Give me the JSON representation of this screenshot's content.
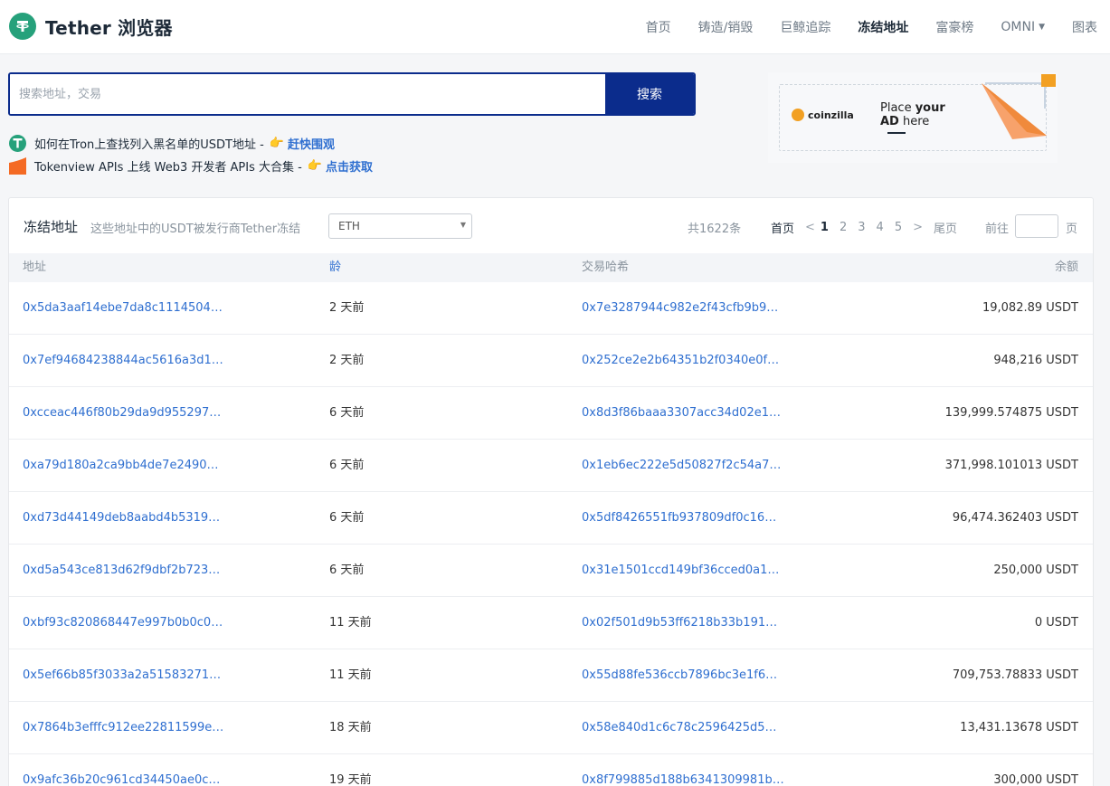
{
  "header": {
    "brand": "Tether 浏览器",
    "nav": [
      {
        "label": "首页"
      },
      {
        "label": "铸造/销毁"
      },
      {
        "label": "巨鲸追踪"
      },
      {
        "label": "冻结地址",
        "active": true
      },
      {
        "label": "富豪榜"
      },
      {
        "label": "OMNI"
      },
      {
        "label": "图表"
      }
    ]
  },
  "search": {
    "placeholder": "搜索地址，交易",
    "button": "搜索"
  },
  "notices": [
    {
      "text": "如何在Tron上查找列入黑名单的USDT地址 -",
      "link": "赶快围观"
    },
    {
      "text": "Tokenview APIs 上线 Web3 开发者 APIs 大合集 -",
      "link": "点击获取"
    }
  ],
  "ad": {
    "brand": "coinzilla",
    "line1_a": "Place ",
    "line1_b": "your",
    "line2_a": "AD",
    "line2_b": " here"
  },
  "panel": {
    "title": "冻结地址",
    "subtitle": "这些地址中的USDT被发行商Tether冻结",
    "chain_select": "ETH",
    "total": "共1622条",
    "pager": {
      "first": "首页",
      "prev": "<",
      "pages": [
        "1",
        "2",
        "3",
        "4",
        "5"
      ],
      "next": ">",
      "last": "尾页",
      "goto": "前往",
      "unit": "页"
    },
    "columns": {
      "address": "地址",
      "age": "龄",
      "tx_hash": "交易哈希",
      "balance": "余额"
    },
    "rows": [
      {
        "address": "0x5da3aaf14ebe7da8c1114504…",
        "age": "2 天前",
        "tx": "0x7e3287944c982e2f43cfb9b9…",
        "balance": "19,082.89 USDT"
      },
      {
        "address": "0x7ef94684238844ac5616a3d1…",
        "age": "2 天前",
        "tx": "0x252ce2e2b64351b2f0340e0f…",
        "balance": "948,216 USDT"
      },
      {
        "address": "0xcceac446f80b29da9d955297…",
        "age": "6 天前",
        "tx": "0x8d3f86baaa3307acc34d02e1…",
        "balance": "139,999.574875 USDT"
      },
      {
        "address": "0xa79d180a2ca9bb4de7e2490…",
        "age": "6 天前",
        "tx": "0x1eb6ec222e5d50827f2c54a7…",
        "balance": "371,998.101013 USDT"
      },
      {
        "address": "0xd73d44149deb8aabd4b5319…",
        "age": "6 天前",
        "tx": "0x5df8426551fb937809df0c16…",
        "balance": "96,474.362403 USDT"
      },
      {
        "address": "0xd5a543ce813d62f9dbf2b723…",
        "age": "6 天前",
        "tx": "0x31e1501ccd149bf36cced0a1…",
        "balance": "250,000 USDT"
      },
      {
        "address": "0xbf93c820868447e997b0b0c0…",
        "age": "11 天前",
        "tx": "0x02f501d9b53ff6218b33b191…",
        "balance": "0 USDT"
      },
      {
        "address": "0x5ef66b85f3033a2a51583271…",
        "age": "11 天前",
        "tx": "0x55d88fe536ccb7896bc3e1f6…",
        "balance": "709,753.78833 USDT"
      },
      {
        "address": "0x7864b3efffc912ee22811599e…",
        "age": "18 天前",
        "tx": "0x58e840d1c6c78c2596425d5…",
        "balance": "13,431.13678 USDT"
      },
      {
        "address": "0x9afc36b20c961cd34450ae0c…",
        "age": "19 天前",
        "tx": "0x8f799885d188b6341309981b…",
        "balance": "300,000 USDT"
      }
    ]
  },
  "colors": {
    "primary": "#0b2c8c",
    "link": "#2f6fd0",
    "tether_green": "#26a17b",
    "accent_orange": "#f2a023"
  }
}
